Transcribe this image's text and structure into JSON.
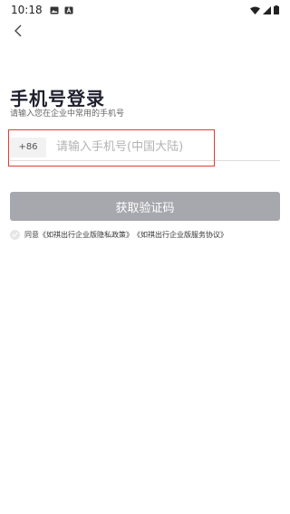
{
  "status_bar": {
    "time": "10:18",
    "left_icons": [
      "image-icon",
      "text-a-icon"
    ],
    "right_icons": [
      "wifi-icon",
      "signal-icon",
      "battery-icon"
    ]
  },
  "header": {
    "back_icon": "chevron-left-icon"
  },
  "login": {
    "title": "手机号登录",
    "subtitle": "请输入您在企业中常用的手机号",
    "country_code": "+86",
    "phone_placeholder": "请输入手机号(中国大陆)",
    "phone_value": "",
    "get_code_label": "获取验证码"
  },
  "agreement": {
    "prefix": "同意",
    "privacy_link": "《如祺出行企业版隐私政策》",
    "service_link": "《如祺出行企业版服务协议》"
  },
  "colors": {
    "button_disabled": "#a7a7ae",
    "highlight": "#e53935",
    "title": "#1f1f2e"
  }
}
